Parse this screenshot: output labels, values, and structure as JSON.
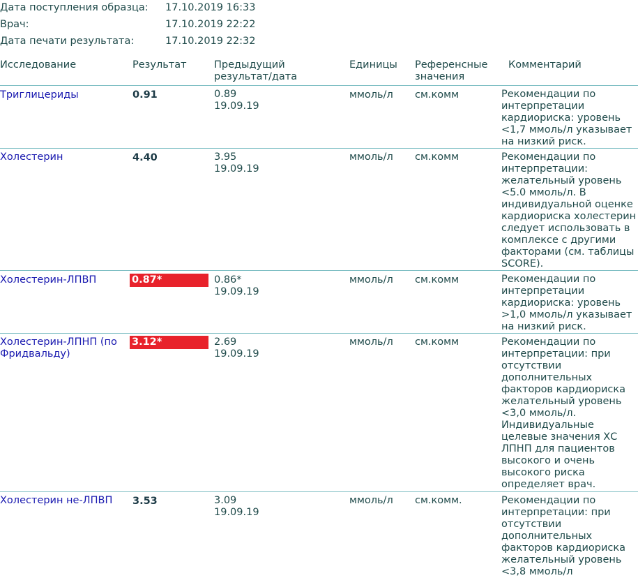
{
  "meta": {
    "received_label": "Дата поступления образца:",
    "received_value": "17.10.2019 16:33",
    "doctor_label": "Врач:",
    "doctor_value": "17.10.2019 22:22",
    "print_label": "Дата печати результата:",
    "print_value": "17.10.2019 22:32"
  },
  "columns": {
    "test": "Исследование",
    "result": "Результат",
    "previous_line1": "Предыдущий",
    "previous_line2": "результат/дата",
    "units": "Единицы",
    "reference_line1": "Референсные",
    "reference_line2": "значения",
    "comment": "Комментарий"
  },
  "rows": [
    {
      "name": "Триглицериды",
      "result": "0.91",
      "abnormal": false,
      "prev_value": "0.89",
      "prev_date": "19.09.19",
      "units": "ммоль/л",
      "reference": "см.комм",
      "comment": "Рекомендации по интерпретации кардиориска: уровень <1,7 ммоль/л указывает на низкий риск."
    },
    {
      "name": "Холестерин",
      "result": "4.40",
      "abnormal": false,
      "prev_value": "3.95",
      "prev_date": "19.09.19",
      "units": "ммоль/л",
      "reference": "см.комм",
      "comment": "Рекомендации по интерпретации: желательный уровень <5.0 ммоль/л. В индивидуальной оценке кардиориска холестерин следует использовать в комплексе с другими факторами (см. таблицы SCORE)."
    },
    {
      "name": "Холестерин-ЛПВП",
      "result": "0.87*",
      "abnormal": true,
      "abnormal_color": "#e8222b",
      "prev_value": "0.86*",
      "prev_date": "19.09.19",
      "units": "ммоль/л",
      "reference": "см.комм",
      "comment": "Рекомендации по интерпретации кардиориска: уровень >1,0 ммоль/л указывает на низкий риск."
    },
    {
      "name": "Холестерин-ЛПНП (по Фридвальду)",
      "result": "3.12*",
      "abnormal": true,
      "abnormal_color": "#e8222b",
      "prev_value": "2.69",
      "prev_date": "19.09.19",
      "units": "ммоль/л",
      "reference": "см.комм",
      "comment": "Рекомендации по интерпретации: при отсутствии дополнительных факторов кардиориска желательный уровень <3,0 ммоль/л. Индивидуальные целевые значения ХС ЛПНП для пациентов высокого и очень высокого риска определяет врач."
    },
    {
      "name": "Холестерин не-ЛПВП",
      "result": "3.53",
      "abnormal": false,
      "prev_value": "3.09",
      "prev_date": "19.09.19",
      "units": "ммоль/л",
      "reference": "см.комм.",
      "comment": "Рекомендации по интерпретации: при отсутствии дополнительных факторов кардиориска желательный уровень <3,8 ммоль/л"
    }
  ]
}
